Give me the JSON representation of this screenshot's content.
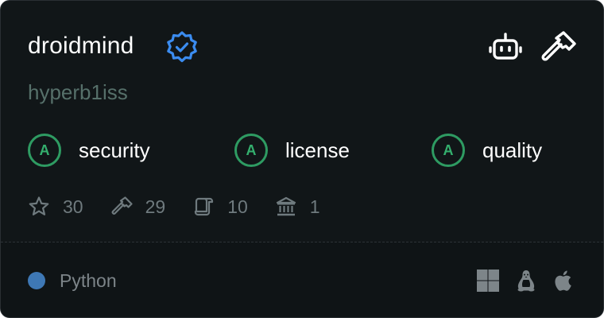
{
  "server": {
    "name": "droidmind",
    "author": "hyperb1iss",
    "verified_icon": "verified-badge-icon",
    "top_icons": [
      "robot-icon",
      "hammer-icon"
    ]
  },
  "grades": [
    {
      "letter": "A",
      "label": "security"
    },
    {
      "letter": "A",
      "label": "license"
    },
    {
      "letter": "A",
      "label": "quality"
    }
  ],
  "stats": [
    {
      "icon": "star-icon",
      "value": "30"
    },
    {
      "icon": "hammer-icon",
      "value": "29"
    },
    {
      "icon": "scroll-icon",
      "value": "10"
    },
    {
      "icon": "bank-icon",
      "value": "1"
    }
  ],
  "footer": {
    "language": "Python",
    "language_color": "#3e78b5",
    "os_icons": [
      "windows-icon",
      "linux-icon",
      "apple-icon"
    ]
  },
  "colors": {
    "background": "#111618",
    "grade_accent": "#2e9b62",
    "verified_blue": "#3b8cf0"
  }
}
